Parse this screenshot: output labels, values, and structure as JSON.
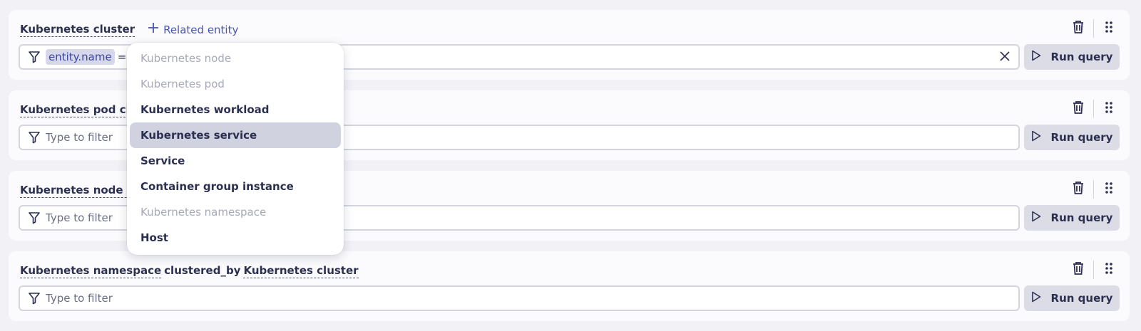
{
  "colors": {
    "background": "#f1f1f6",
    "card": "#fbfbfd",
    "accent": "#4754b4",
    "text": "#2c3050",
    "disabled_text": "#a7a9ba",
    "highlight": "#d1d2e0"
  },
  "icons": [
    "plus-icon",
    "filter-icon",
    "close-icon",
    "play-icon",
    "trash-icon",
    "drag-handle-icon"
  ],
  "cards": [
    {
      "title_entity": "Kubernetes cluster",
      "related_label": "Related entity",
      "filter_key": "entity.name",
      "filter_op": "= dt",
      "run_label": "Run query"
    },
    {
      "title_entity": "Kubernetes pod clus",
      "placeholder": "Type to filter",
      "run_label": "Run query"
    },
    {
      "title_entity": "Kubernetes node clu",
      "placeholder": "Type to filter",
      "run_label": "Run query"
    },
    {
      "title_entity": "Kubernetes namespace",
      "relation": "clustered_by",
      "target_entity": "Kubernetes cluster",
      "placeholder": "Type to filter",
      "run_label": "Run query"
    }
  ],
  "dropdown": {
    "items": [
      {
        "label": "Kubernetes node",
        "disabled": true
      },
      {
        "label": "Kubernetes pod",
        "disabled": true
      },
      {
        "label": "Kubernetes workload",
        "disabled": false
      },
      {
        "label": "Kubernetes service",
        "disabled": false,
        "highlighted": true
      },
      {
        "label": "Service",
        "disabled": false
      },
      {
        "label": "Container group instance",
        "disabled": false
      },
      {
        "label": "Kubernetes namespace",
        "disabled": true
      },
      {
        "label": "Host",
        "disabled": false
      }
    ]
  }
}
